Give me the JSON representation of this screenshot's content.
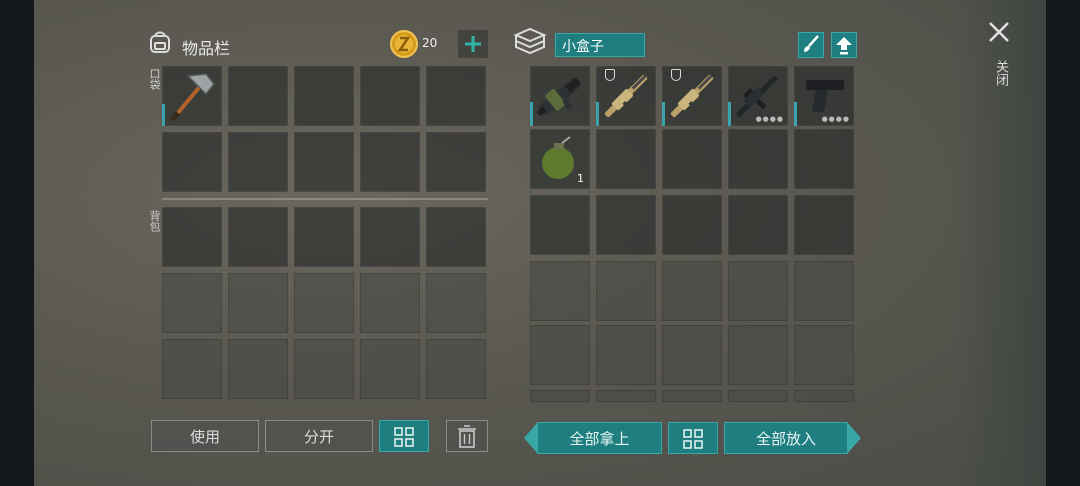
{
  "inventory": {
    "title": "物品栏",
    "coins": "20",
    "pocket_label": "口袋",
    "backpack_label": "背包"
  },
  "container": {
    "name": "小盒子",
    "grenade_count": "1"
  },
  "buttons": {
    "use": "使用",
    "split": "分开",
    "take_all": "全部拿上",
    "put_all": "全部放入"
  },
  "close": {
    "label": "关闭"
  },
  "icons": {
    "backpack": "backpack-icon",
    "coin": "coin-icon",
    "add": "plus-icon",
    "box": "box-icon",
    "brush": "brush-icon",
    "upload": "upload-arrow-icon",
    "sort": "grid-sort-icon",
    "trash": "trash-icon",
    "close": "close-icon"
  },
  "colors": {
    "accent": "#1f7e7f",
    "durability": "#3aa3ad",
    "coin": "#d79b1c"
  }
}
